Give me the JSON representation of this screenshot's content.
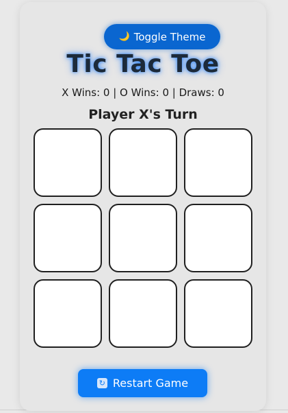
{
  "theme_toggle": {
    "icon": "moon-icon",
    "icon_glyph": "🌙",
    "label": "Toggle Theme"
  },
  "title": "Tic Tac Toe",
  "scoreboard": {
    "text": "X Wins: 0 | O Wins: 0 | Draws: 0",
    "x_wins": 0,
    "o_wins": 0,
    "draws": 0
  },
  "status": "Player X's Turn",
  "board": {
    "cells": [
      "",
      "",
      "",
      "",
      "",
      "",
      "",
      "",
      ""
    ]
  },
  "restart": {
    "icon": "refresh-icon",
    "icon_glyph": "↻",
    "label": "Restart Game"
  },
  "colors": {
    "accent": "#0a66d0",
    "restart_button": "#0d7cf6",
    "title_glow": "#006eff",
    "card_background": "#e6e6e6"
  }
}
